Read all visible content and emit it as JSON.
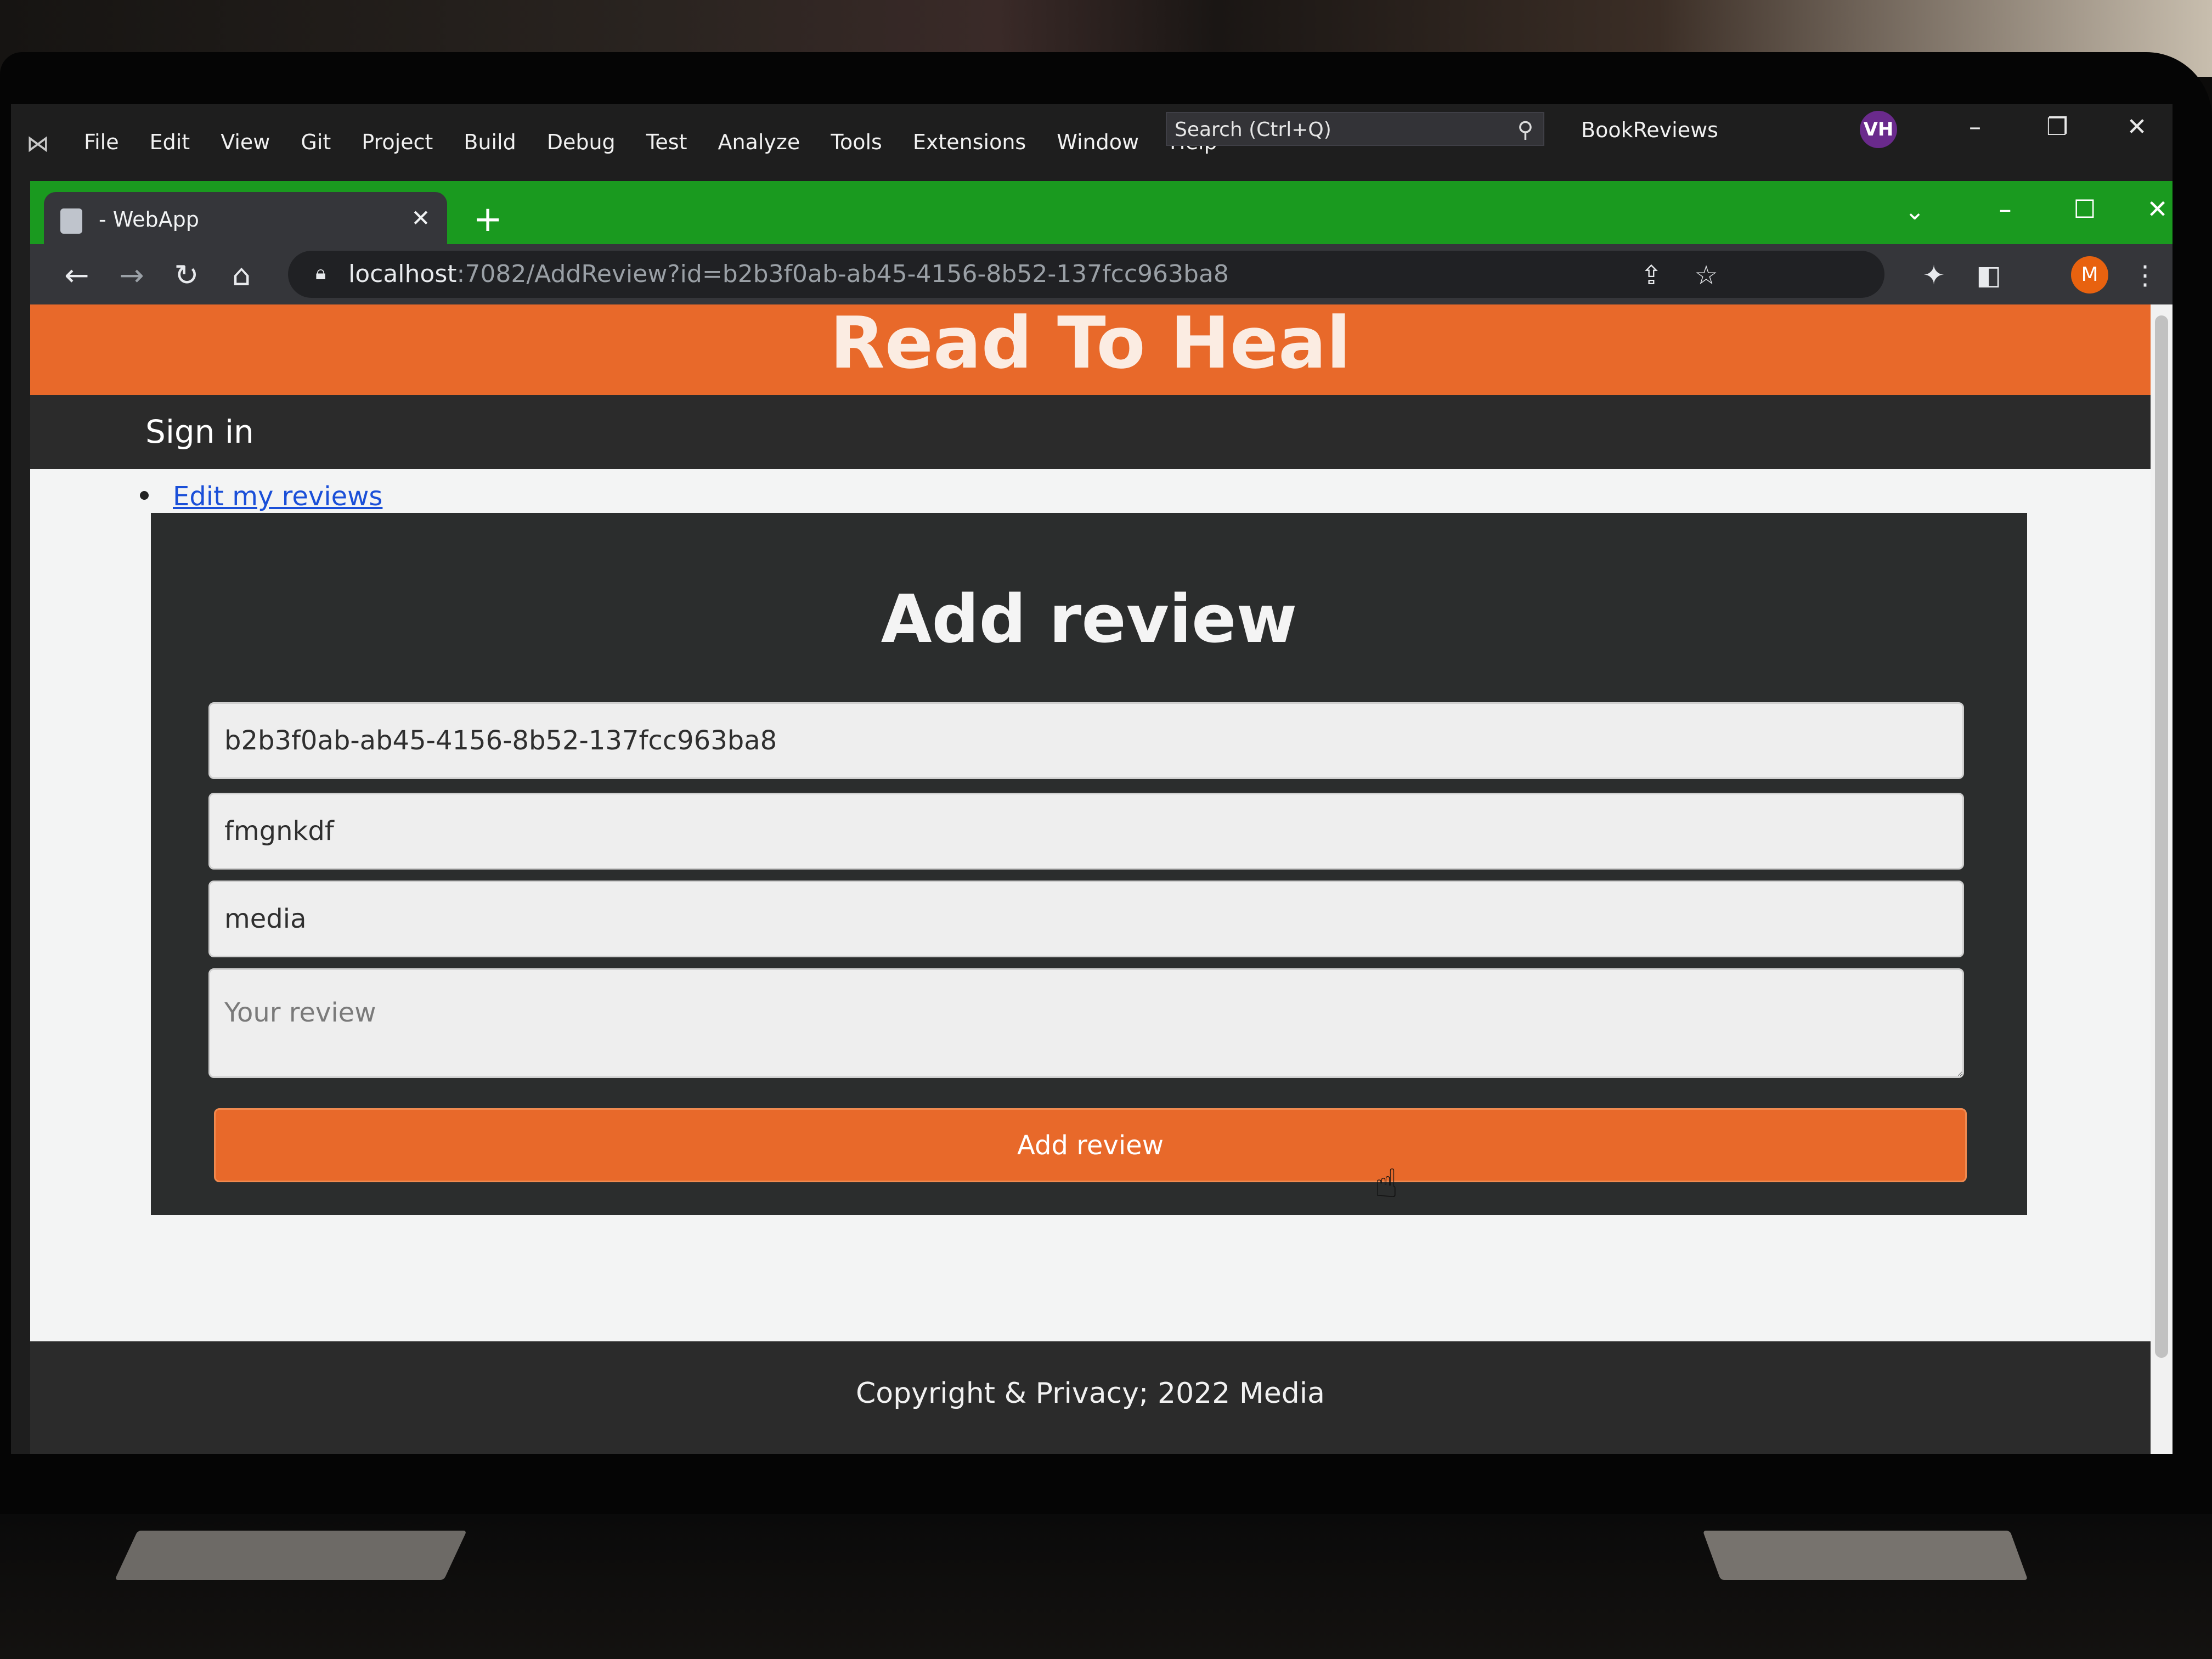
{
  "vs": {
    "menu": [
      "File",
      "Edit",
      "View",
      "Git",
      "Project",
      "Build",
      "Debug",
      "Test",
      "Analyze",
      "Tools",
      "Extensions",
      "Window",
      "Help"
    ],
    "search_placeholder": "Search (Ctrl+Q)",
    "solution_name": "BookReviews",
    "avatar_initials": "VH"
  },
  "browser": {
    "tab_title": "- WebApp",
    "url_host": "localhost",
    "url_rest": ":7082/AddReview?id=b2b3f0ab-ab45-4156-8b52-137fcc963ba8",
    "profile_initial": "M",
    "tab_strip_color": "#1a9a1f"
  },
  "site": {
    "title": "Read To Heal",
    "nav_sign_in": "Sign in",
    "link_edit_reviews": "Edit my reviews",
    "accent_color": "#e8692a"
  },
  "form": {
    "heading": "Add review",
    "book_id_value": "b2b3f0ab-ab45-4156-8b52-137fcc963ba8",
    "title_value": "fmgnkdf",
    "author_value": "media",
    "review_placeholder": "Your review",
    "submit_label": "Add review"
  },
  "footer": {
    "text": "Copyright & Privacy; 2022 Media"
  }
}
